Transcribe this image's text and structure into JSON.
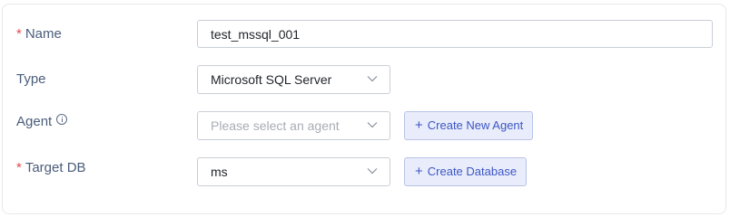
{
  "form": {
    "name": {
      "required_mark": "*",
      "label": "Name",
      "value": "test_mssql_001"
    },
    "type": {
      "label": "Type",
      "value": "Microsoft SQL Server"
    },
    "agent": {
      "label": "Agent",
      "info_icon": "info-circle-icon",
      "placeholder": "Please select an agent",
      "create_button": "Create New Agent"
    },
    "target_db": {
      "required_mark": "*",
      "label": "Target DB",
      "value": "ms",
      "create_button": "Create Database"
    }
  },
  "icons": {
    "dropdown": "chevron-down-icon",
    "add": "plus-icon",
    "info": "info-circle-icon"
  },
  "colors": {
    "label_text": "#4a5d7a",
    "required_mark": "#e5484d",
    "button_text": "#3d56c4",
    "button_bg": "#e9edfb",
    "button_border": "#b9c3e6",
    "input_border": "#c9ced6",
    "placeholder_text": "#a8adb5"
  }
}
